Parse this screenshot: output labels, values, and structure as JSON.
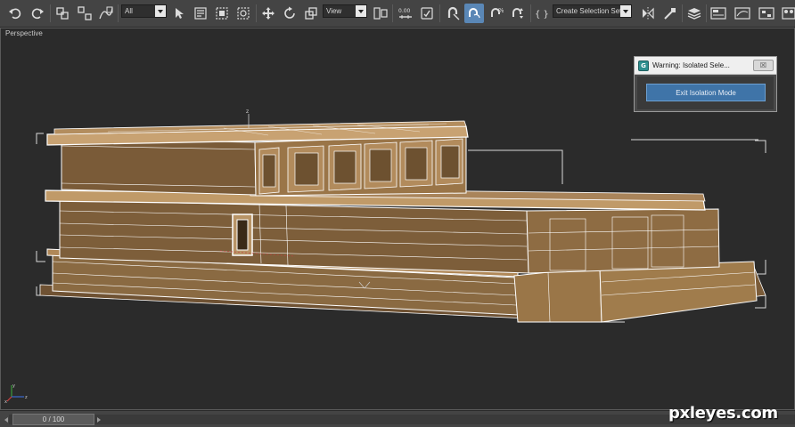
{
  "toolbar": {
    "selection_filter": "All",
    "reference_coordinate": "View",
    "named_selection": "Create Selection Set",
    "icons": [
      "undo-icon",
      "redo-icon",
      "select-and-link-icon",
      "unlink-selection-icon",
      "bind-to-space-warp-icon",
      "select-object-icon",
      "select-by-name-icon",
      "rectangular-selection-region-icon",
      "window-crossing-icon",
      "select-and-move-icon",
      "select-and-rotate-icon",
      "select-and-scale-icon",
      "use-pivot-center-icon",
      "select-and-manipulate-icon",
      "keyboard-shortcut-override-icon",
      "snaps-toggle-icon",
      "angle-snap-icon",
      "percent-snap-icon",
      "spinner-snap-icon",
      "edit-named-selection-icon",
      "mirror-icon",
      "align-icon",
      "layer-manager-icon",
      "ribbon-icon",
      "curve-editor-icon",
      "schematic-view-icon",
      "material-editor-icon",
      "render-setup-icon"
    ]
  },
  "viewport": {
    "label": "Perspective",
    "axis_labels": {
      "x": "x",
      "y": "y",
      "z": "z"
    },
    "gizmo_label": "z"
  },
  "dialog": {
    "title": "Warning: Isolated Sele...",
    "close_label": "☒",
    "app_icon_letter": "G",
    "button_label": "Exit Isolation Mode"
  },
  "timeline": {
    "frame_label": "0 / 100",
    "current_frame": 0,
    "total_frames": 100
  },
  "watermark": {
    "text": "pxleyes.com"
  },
  "colors": {
    "toolbar_bg": "#444444",
    "viewport_bg": "#2b2b2b",
    "model_fill": "#8a6a42",
    "wireframe": "#ffffff",
    "selection_bracket": "#d8d8d8",
    "accent_button": "#3f74a8"
  }
}
